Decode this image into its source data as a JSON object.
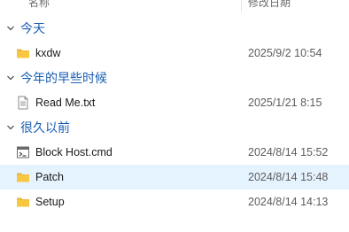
{
  "header": {
    "name_column": "名称",
    "date_column": "修改日期"
  },
  "groups": [
    {
      "label": "今天",
      "items": [
        {
          "name": "kxdw",
          "date": "2025/9/2 10:54",
          "icon": "folder-icon"
        }
      ]
    },
    {
      "label": "今年的早些时候",
      "items": [
        {
          "name": "Read Me.txt",
          "date": "2025/1/21 8:15",
          "icon": "text-file-icon"
        }
      ]
    },
    {
      "label": "很久以前",
      "items": [
        {
          "name": "Block Host.cmd",
          "date": "2024/8/14 15:52",
          "icon": "cmd-file-icon"
        },
        {
          "name": "Patch",
          "date": "2024/8/14 15:48",
          "icon": "folder-icon",
          "selected": true
        },
        {
          "name": "Setup",
          "date": "2024/8/14 14:13",
          "icon": "folder-icon"
        }
      ]
    }
  ],
  "colors": {
    "group_label": "#1a5fb4",
    "selection": "#e5f3ff",
    "folder": "#f8c73f"
  }
}
